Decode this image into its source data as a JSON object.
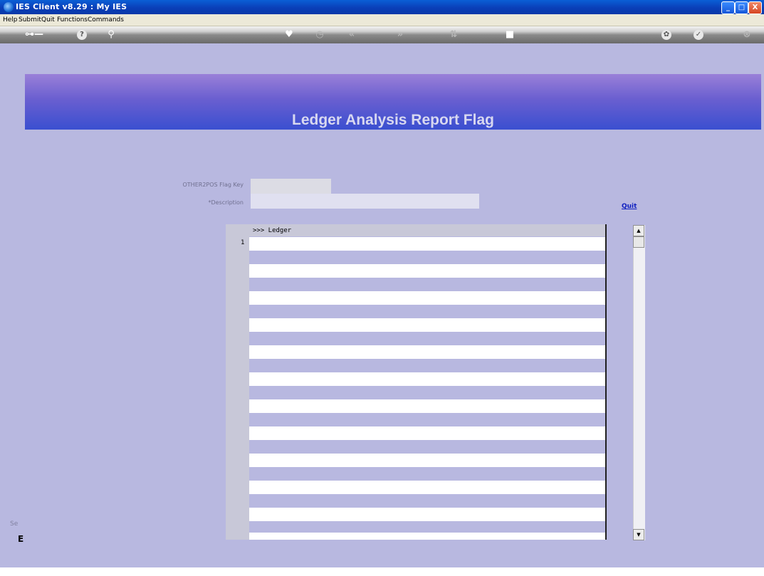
{
  "window": {
    "title": "IES Client v8.29 : My IES",
    "controls": {
      "minimize": "_",
      "maximize": "□",
      "close": "X"
    }
  },
  "menu": [
    "Help",
    "Submit",
    "Quit",
    "Functions",
    "Commands"
  ],
  "toolbar": {
    "icons": [
      "key-icon",
      "help-icon",
      "search-icon",
      "heart-icon",
      "clock-icon",
      "rewind-icon",
      "fast-forward-icon",
      "sort-icon",
      "stop-icon",
      "gear-icon",
      "check-icon",
      "close-icon"
    ]
  },
  "header": {
    "title": "Ledger Analysis Report Flag"
  },
  "form": {
    "flag_key_label": "OTHER2POS Flag Key",
    "flag_key_value": "",
    "description_label": "*Description",
    "description_value": "",
    "quit_link": "Quit"
  },
  "grid": {
    "header": ">>> Ledger",
    "rows": [
      {
        "num": "1",
        "value": ""
      }
    ]
  },
  "status": {
    "fragment": "Se",
    "box": "E"
  }
}
